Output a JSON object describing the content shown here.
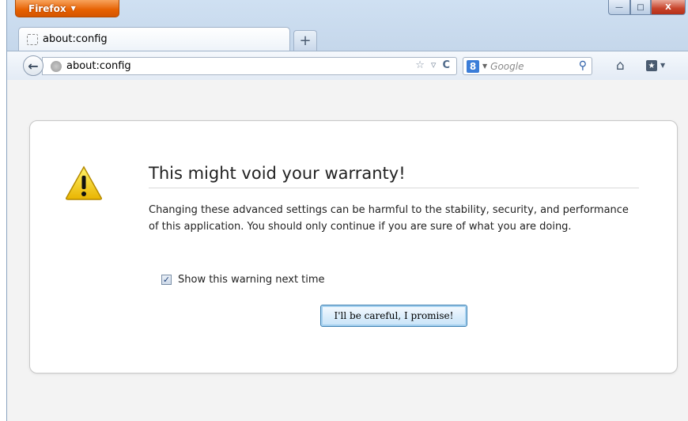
{
  "app": {
    "menu_button": "Firefox",
    "window_controls": {
      "minimize": "—",
      "maximize": "□",
      "close": "X"
    }
  },
  "tabs": [
    {
      "label": "about:config",
      "active": true
    }
  ],
  "new_tab_symbol": "+",
  "nav": {
    "url": "about:config",
    "search_engine": "Google",
    "search_placeholder": "Google"
  },
  "warning": {
    "title": "This might void your warranty!",
    "body": "Changing these advanced settings can be harmful to the stability, security, and performance of this application. You should only continue if you are sure of what you are doing.",
    "checkbox_label": "Show this warning next time",
    "checkbox_checked": true,
    "button_label": "I'll be careful, I promise!"
  },
  "colors": {
    "firefox_orange": "#e66000",
    "warning_yellow": "#f4c400"
  }
}
